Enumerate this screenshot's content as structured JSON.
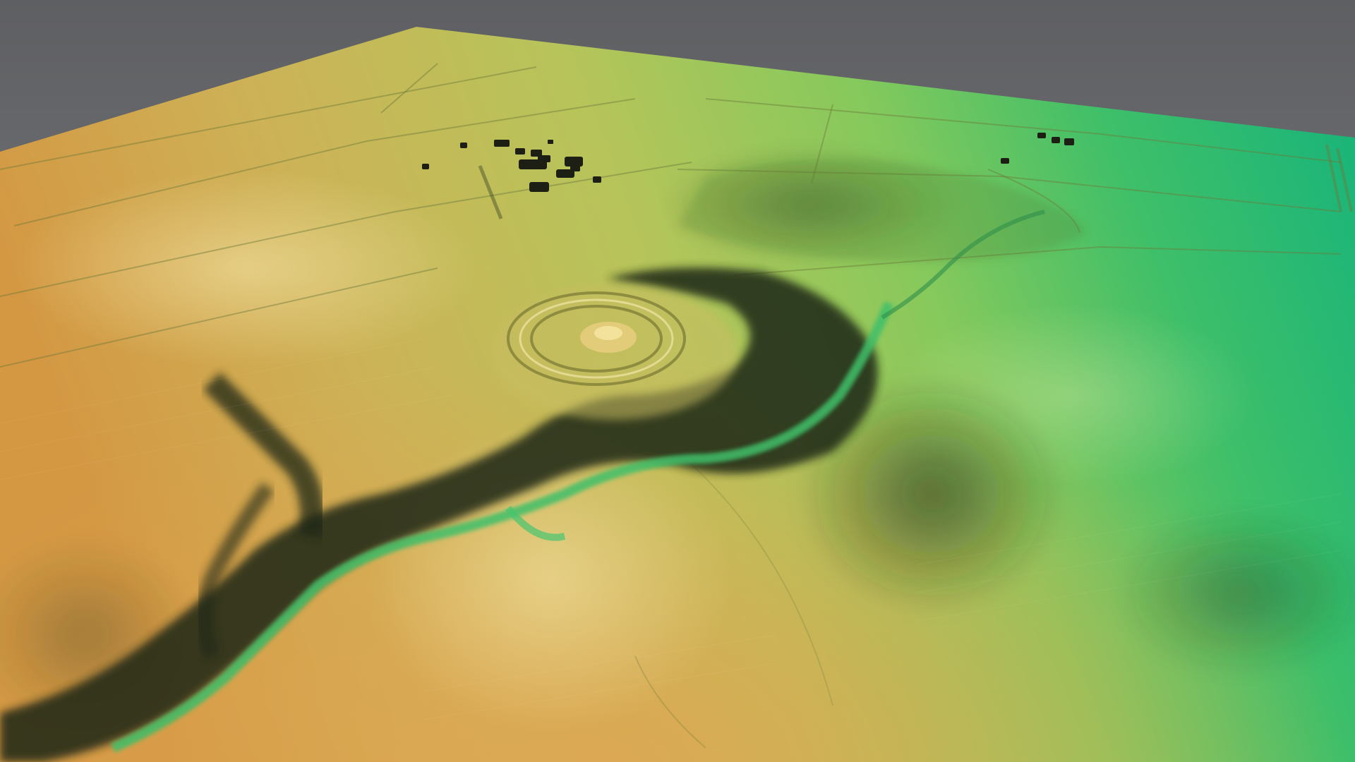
{
  "scene": {
    "background_color": "#727376",
    "color_ramp": [
      "#d69a46",
      "#cfb45a",
      "#b9c45a",
      "#8ccb5c",
      "#3fbf6a",
      "#15b27a"
    ],
    "features": [
      {
        "kind": "terrain-surface",
        "description_icon": "elevation-map"
      },
      {
        "kind": "hillfort-rings",
        "description_icon": "concentric-ramparts"
      },
      {
        "kind": "stream-valley",
        "description_icon": "river-gorge"
      },
      {
        "kind": "farm-buildings-west",
        "description_icon": "building-cluster"
      },
      {
        "kind": "farm-buildings-east",
        "description_icon": "building-cluster"
      },
      {
        "kind": "field-boundaries",
        "description_icon": "linear-earthworks"
      }
    ]
  }
}
